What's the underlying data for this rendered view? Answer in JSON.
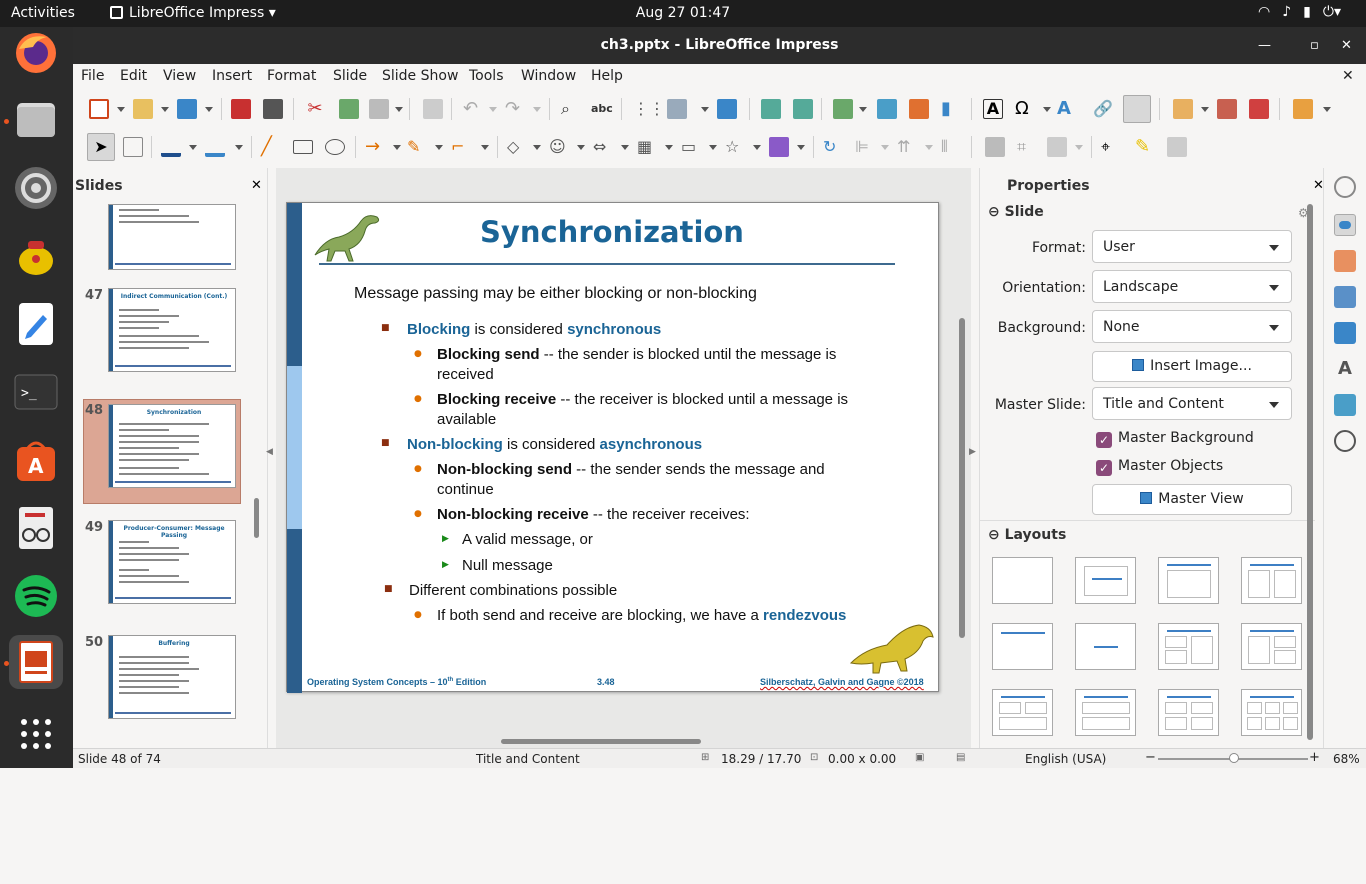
{
  "topbar": {
    "activities": "Activities",
    "app": "LibreOffice Impress",
    "clock": "Aug 27  01:47"
  },
  "window": {
    "title": "ch3.pptx - LibreOffice Impress"
  },
  "menu": [
    "File",
    "Edit",
    "View",
    "Insert",
    "Format",
    "Slide",
    "Slide Show",
    "Tools",
    "Window",
    "Help"
  ],
  "slides_panel": {
    "title": "Slides",
    "thumbs": [
      {
        "num": "",
        "title": ""
      },
      {
        "num": "47",
        "title": "Indirect Communication (Cont.)"
      },
      {
        "num": "48",
        "title": "Synchronization",
        "selected": true
      },
      {
        "num": "49",
        "title": "Producer-Consumer: Message Passing"
      },
      {
        "num": "50",
        "title": "Buffering"
      }
    ]
  },
  "slide": {
    "title": "Synchronization",
    "intro": "Message passing may be either blocking or non-blocking",
    "l1a_kw": "Blocking",
    "l1a_mid": " is considered ",
    "l1a_kw2": "synchronous",
    "l2a_b": "Blocking send",
    "l2a_t": " -- the sender is blocked until the message is",
    "l2a_t2": "received",
    "l2b_b": "Blocking receive",
    "l2b_t": " -- the receiver is  blocked until a message is",
    "l2b_t2": "available",
    "l1b_kw": "Non-blocking",
    "l1b_mid": " is considered ",
    "l1b_kw2": "asynchronous",
    "l2c_b": "Non-blocking send",
    "l2c_t": " -- the sender sends the message and",
    "l2c_t2": "continue",
    "l2d_b": "Non-blocking receive",
    "l2d_t": " -- the receiver receives:",
    "l3a": "A valid message,  or",
    "l3b": "Null message",
    "l1c": "Different combinations possible",
    "l2e_t": "If both send and receive are blocking, we have a ",
    "l2e_kw": "rendezvous",
    "foot_left": "Operating System Concepts – 10",
    "foot_left_sup": "th",
    "foot_left_end": " Edition",
    "foot_mid": "3.48",
    "foot_right": "Silberschatz, Galvin and Gagne ©2018"
  },
  "properties": {
    "title": "Properties",
    "section_slide": "Slide",
    "format_label": "Format:",
    "format_value": "User",
    "orientation_label": "Orientation:",
    "orientation_value": "Landscape",
    "background_label": "Background:",
    "background_value": "None",
    "insert_image": "Insert Image...",
    "master_slide_label": "Master Slide:",
    "master_slide_value": "Title and Content",
    "master_background": "Master Background",
    "master_objects": "Master Objects",
    "master_view": "Master View",
    "section_layouts": "Layouts"
  },
  "status": {
    "slide": "Slide 48 of 74",
    "layout": "Title and Content",
    "position": "18.29 / 17.70",
    "size": "0.00 x 0.00",
    "language": "English (USA)",
    "zoom": "68%"
  },
  "colors": {
    "accent": "#1a6496",
    "dock": "#2b2b2b",
    "ubuntu_orange": "#e95420",
    "selected_thumb": "#dca694"
  }
}
